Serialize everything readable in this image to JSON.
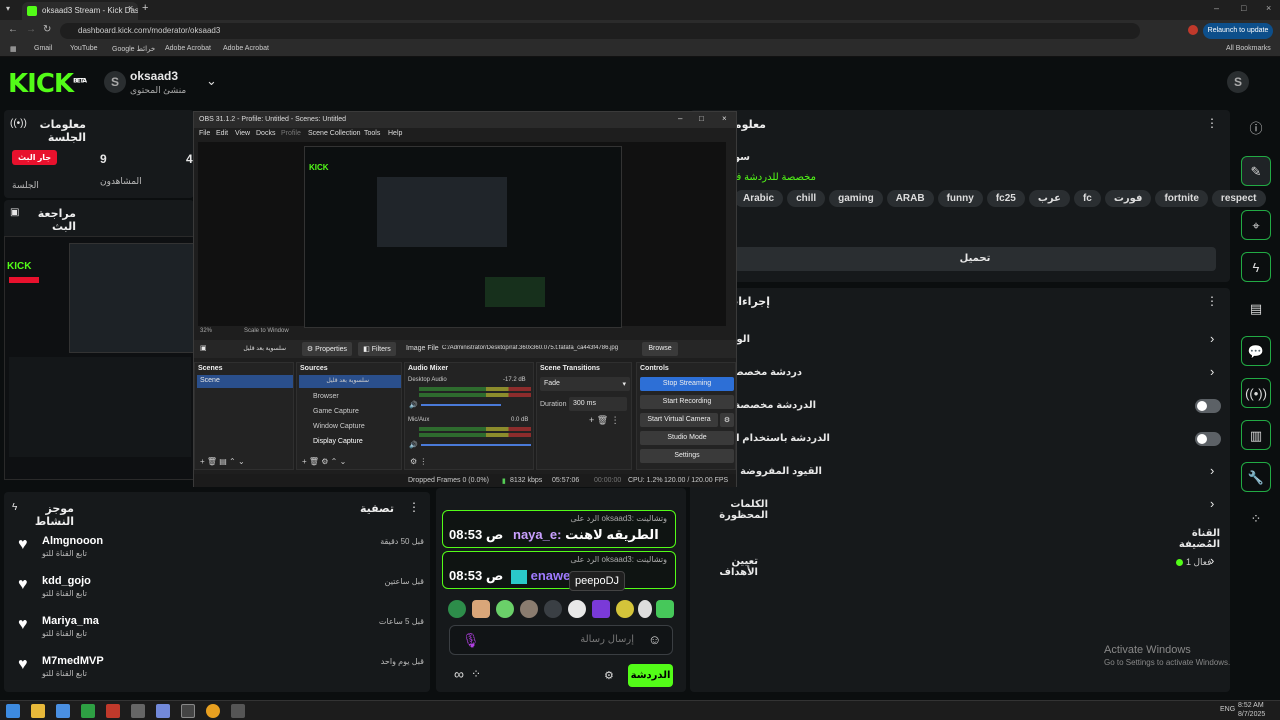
{
  "browser": {
    "tab_title": "oksaad3 Stream - Kick Dashbo",
    "url": "dashboard.kick.com/moderator/oksaad3",
    "relaunch": "Relaunch to update",
    "bookmarks": [
      "Gmail",
      "YouTube",
      "Google خرائط",
      "Adobe Acrobat",
      "Adobe Acrobat"
    ],
    "all_bookmarks": "All Bookmarks"
  },
  "header": {
    "logo": "KICK",
    "logo_badge": "BETA",
    "channel_initial": "S",
    "channel_name": "oksaad3",
    "channel_role": "منشئ المحتوى",
    "user_initial": "S"
  },
  "session": {
    "title": "معلومات الجلسة",
    "live_badge": "جار البث",
    "live_caption": "الجلسة",
    "viewers": "9",
    "viewers_label": "المشاهدون",
    "third_value": "4"
  },
  "preview": {
    "title": "مراجعة البث"
  },
  "stream_info": {
    "title": "معلومات",
    "line_partial": "سو",
    "chat_note": "مخصصة للدردشة فقط",
    "tags": [
      "Arabic",
      "chill",
      "gaming",
      "ARAB",
      "funny",
      "fc25",
      "عرب",
      "fc",
      "فورت",
      "fortnite",
      "respect"
    ],
    "edit_button": "تحميل"
  },
  "actions": {
    "title": "إجراءات",
    "items": [
      "الوضع",
      "دردشة مخصصة للمتابعين",
      "الدردشة مخصصة للمشتركين",
      "الدردشة باستخدام الصور الرمزية فقط",
      "القيود المفروضة على حسابات",
      "الكلمات المحظورة"
    ],
    "pinned_section": "القناة المُضيفة",
    "goals": "تعيين الأهداف",
    "goals_status": "فعال 1"
  },
  "activity": {
    "title": "موجز النشاط",
    "filter": "تصفية",
    "rows": [
      {
        "name": "Almgnooon",
        "sub": "تابع القناة للتو",
        "time": "قبل 50 دقيقة"
      },
      {
        "name": "kdd_gojo",
        "sub": "تابع القناة للتو",
        "time": "قبل ساعتين"
      },
      {
        "name": "Mariya_ma",
        "sub": "تابع القناة للتو",
        "time": "قبل 5 ساعات"
      },
      {
        "name": "M7medMVP",
        "sub": "تابع القناة للتو",
        "time": "قبل يوم واحد"
      }
    ]
  },
  "chat": {
    "messages": [
      {
        "reply": "الرد على oksaad3: وتشالينت",
        "user": "naya_e",
        "text": "الطريقه لاهنت",
        "time": "08:53 ص"
      },
      {
        "reply": "الرد على oksaad3: وتشالينت",
        "user": "enawe",
        "text": "",
        "time": "08:53 ص"
      }
    ],
    "tooltip": "peepoDJ",
    "input_placeholder": "إرسال رسالة",
    "send_button": "الدردشة"
  },
  "obs": {
    "title": "OBS 31.1.2 - Profile: Untitled - Scenes: Untitled",
    "menu": [
      "File",
      "Edit",
      "View",
      "Docks",
      "Profile",
      "Scene Collection",
      "Tools",
      "Help"
    ],
    "zoom": "32%",
    "scale_mode": "Scale to Window",
    "source_label": "سلسوية بعد قليل",
    "properties": "Properties",
    "filters": "Filters",
    "image_file": "Image File",
    "file_path": "C:/Administrator/Desktop/raf.360x360.075.t.fafafa_ca443f4786.jpg",
    "browse": "Browse",
    "docks": {
      "scenes": "Scenes",
      "sources": "Sources",
      "mixer": "Audio Mixer",
      "transitions": "Scene Transitions",
      "controls": "Controls"
    },
    "scenes": [
      "Scene"
    ],
    "sources": [
      "سلسوية بعد قليل",
      "Browser",
      "Game Capture",
      "Window Capture",
      "Display Capture"
    ],
    "mixer": [
      {
        "name": "Desktop Audio",
        "db": "-17.2 dB"
      },
      {
        "name": "Mic/Aux",
        "db": "0.0 dB"
      }
    ],
    "transition": "Fade",
    "duration_label": "Duration",
    "duration": "300 ms",
    "controls": [
      "Stop Streaming",
      "Start Recording",
      "Start Virtual Camera",
      "Studio Mode",
      "Settings"
    ],
    "status": {
      "dropped": "Dropped Frames 0 (0.0%)",
      "kbps": "8132 kbps",
      "time": "05:57:06",
      "rec": "00:00:00",
      "cpu": "CPU: 1.2%",
      "fps": "120.00 / 120.00 FPS"
    }
  },
  "windows": {
    "activate_title": "Activate Windows",
    "activate_sub": "Go to Settings to activate Windows.",
    "clock_time": "8:52 AM",
    "clock_date": "8/7/2025",
    "lang": "ENG"
  },
  "colors": {
    "accent": "#53fc18",
    "live": "#e8112d",
    "panel": "#16191b"
  }
}
